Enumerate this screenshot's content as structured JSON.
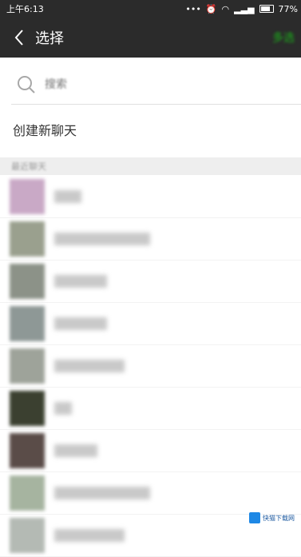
{
  "status": {
    "time": "上午6:13",
    "battery": "77%"
  },
  "nav": {
    "title": "选择",
    "multi_select": "多选"
  },
  "search": {
    "placeholder": "搜索"
  },
  "new_chat": "创建新聊天",
  "section_header": "最近聊天",
  "contacts": [
    {
      "avatar_color": "#c9a9c6"
    },
    {
      "avatar_color": "#9aa08e"
    },
    {
      "avatar_color": "#8c9288"
    },
    {
      "avatar_color": "#8e9896"
    },
    {
      "avatar_color": "#9ea39a"
    },
    {
      "avatar_color": "#3b4030"
    },
    {
      "avatar_color": "#5a4c48"
    },
    {
      "avatar_color": "#a6b4a0"
    },
    {
      "avatar_color": "#b4bab4"
    }
  ],
  "watermark": "快猫下载网",
  "colors": {
    "nav_bg": "#2b2b2b",
    "accent": "#1aad19"
  }
}
